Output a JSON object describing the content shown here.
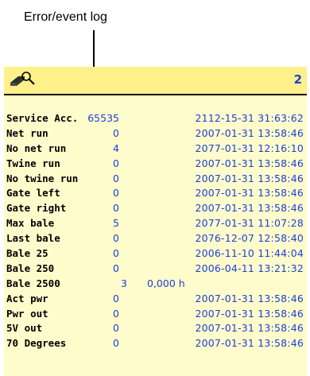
{
  "callout": {
    "label": "Error/event log"
  },
  "header": {
    "page_number": "2",
    "icon": "eraser-search-icon"
  },
  "colors": {
    "screen_bg": "#fffccc",
    "header_bg": "#fff08a",
    "value_blue": "#1a3fd9"
  },
  "rows": [
    {
      "label": "Service Acc.",
      "count": "65535",
      "datetime": "2112-15-31 31:63:62"
    },
    {
      "label": "Net run",
      "count": "0",
      "datetime": "2007-01-31 13:58:46"
    },
    {
      "label": "No net run",
      "count": "4",
      "datetime": "2077-01-31 12:16:10"
    },
    {
      "label": "Twine run",
      "count": "0",
      "datetime": "2007-01-31 13:58:46"
    },
    {
      "label": "No twine run",
      "count": "0",
      "datetime": "2007-01-31 13:58:46"
    },
    {
      "label": "Gate left",
      "count": "0",
      "datetime": "2007-01-31 13:58:46"
    },
    {
      "label": "Gate right",
      "count": "0",
      "datetime": "2007-01-31 13:58:46"
    },
    {
      "label": "Max bale",
      "count": "5",
      "datetime": "2077-01-31 11:07:28"
    },
    {
      "label": "Last bale",
      "count": "0",
      "datetime": "2076-12-07 12:58:40"
    },
    {
      "label": "Bale 25",
      "count": "0",
      "datetime": "2006-11-10 11:44:04"
    },
    {
      "label": "Bale 250",
      "count": "0",
      "datetime": "2006-04-11 13:21:32"
    },
    {
      "label": "Bale 2500",
      "count": "3",
      "hours": "0,000 h"
    },
    {
      "label": "Act pwr",
      "count": "0",
      "datetime": "2007-01-31 13:58:46"
    },
    {
      "label": "Pwr out",
      "count": "0",
      "datetime": "2007-01-31 13:58:46"
    },
    {
      "label": "5V out",
      "count": "0",
      "datetime": "2007-01-31 13:58:46"
    },
    {
      "label": "70 Degrees",
      "count": "0",
      "datetime": "2007-01-31 13:58:46"
    }
  ]
}
